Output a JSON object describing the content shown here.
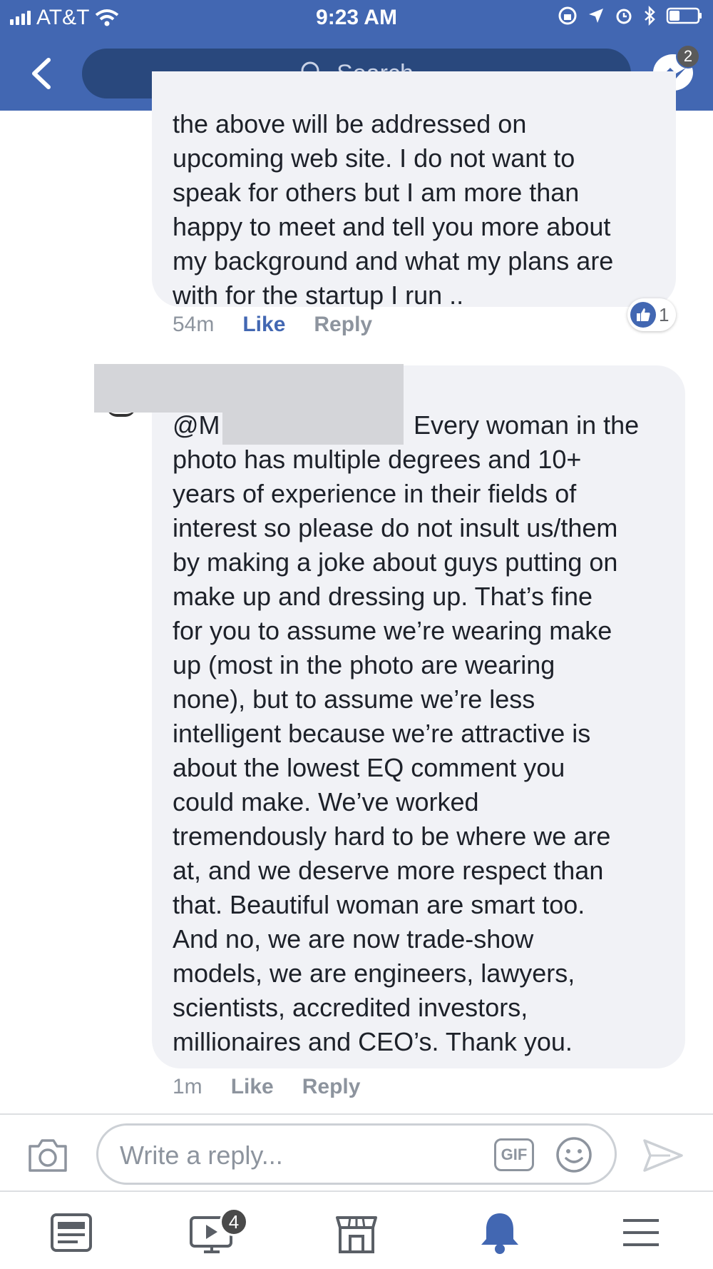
{
  "status_bar": {
    "carrier": "AT&T",
    "time": "9:23 AM"
  },
  "header": {
    "search_placeholder": "Search",
    "messenger_badge": "2"
  },
  "comments": [
    {
      "text": "the above will be addressed on\nupcoming web site. I do not want to\nspeak for others but I am more than\nhappy to meet and tell you more about\nmy background and what my plans are\nwith for the startup I run ..",
      "time": "54m",
      "like_label": "Like",
      "reply_label": "Reply",
      "reaction_count": "1"
    },
    {
      "mention": "@M",
      "text": "Every woman in the\nphoto has multiple degrees and 10+\nyears of experience in their fields of\ninterest so please do not insult us/them\nby making a joke about guys putting on\nmake up and dressing up. That’s fine\nfor you to assume we’re wearing make\nup (most in the photo are wearing\nnone), but to assume we’re less\nintelligent because we’re attractive is\nabout the lowest EQ comment you\ncould make. We’ve worked\ntremendously hard to be where we are\nat, and we deserve more respect than\nthat. Beautiful woman are smart too.\nAnd no, we are now trade-show\nmodels, we are engineers, lawyers,\nscientists, accredited investors,\nmillionaires and CEO’s. Thank you.",
      "time": "1m",
      "like_label": "Like",
      "reply_label": "Reply"
    }
  ],
  "composer": {
    "placeholder": "Write a reply...",
    "gif_label": "GIF"
  },
  "bottom_nav": {
    "video_badge": "4",
    "items": [
      "news-feed-icon",
      "watch-icon",
      "marketplace-icon",
      "notifications-icon",
      "menu-icon"
    ]
  },
  "colors": {
    "brand": "#4267b2",
    "bubble": "#f1f2f6",
    "meta_text": "#8d949e"
  }
}
